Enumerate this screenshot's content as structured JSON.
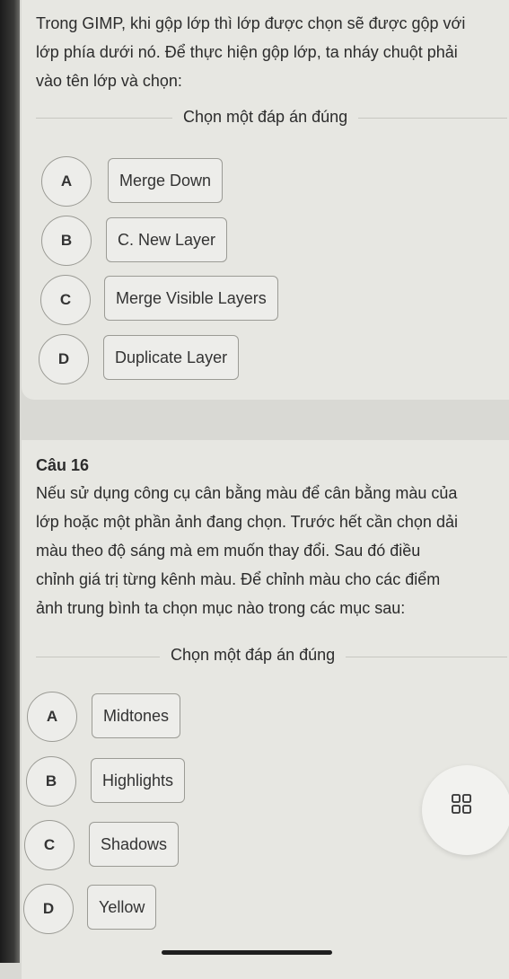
{
  "question_prev": {
    "text_lines": [
      "Trong GIMP, khi gộp lớp thì lớp được chọn sẽ được gộp với",
      "lớp phía dưới nó. Để thực hiện gộp lớp, ta nháy chuột phải",
      "vào tên lớp và chọn:"
    ],
    "prompt": "Chọn một đáp án đúng",
    "options": [
      {
        "letter": "A",
        "label": "Merge Down"
      },
      {
        "letter": "B",
        "label": "C. New Layer"
      },
      {
        "letter": "C",
        "label": "Merge Visible Layers"
      },
      {
        "letter": "D",
        "label": "Duplicate Layer"
      }
    ]
  },
  "question_16": {
    "title": "Câu 16",
    "text_lines": [
      "Nếu sử dụng công cụ cân bằng màu để cân bằng màu của",
      "lớp hoặc một phần ảnh đang chọn. Trước hết cần chọn dải",
      "màu theo độ sáng mà em muốn thay đổi. Sau đó điều",
      "chỉnh giá trị từng kênh màu. Để chỉnh màu cho các điểm",
      "ảnh trung bình ta chọn mục nào trong các mục sau:"
    ],
    "prompt": "Chọn một đáp án đúng",
    "options": [
      {
        "letter": "A",
        "label": "Midtones"
      },
      {
        "letter": "B",
        "label": "Highlights"
      },
      {
        "letter": "C",
        "label": "Shadows"
      },
      {
        "letter": "D",
        "label": "Yellow"
      }
    ]
  },
  "icons": {
    "fab": "grid-icon"
  }
}
